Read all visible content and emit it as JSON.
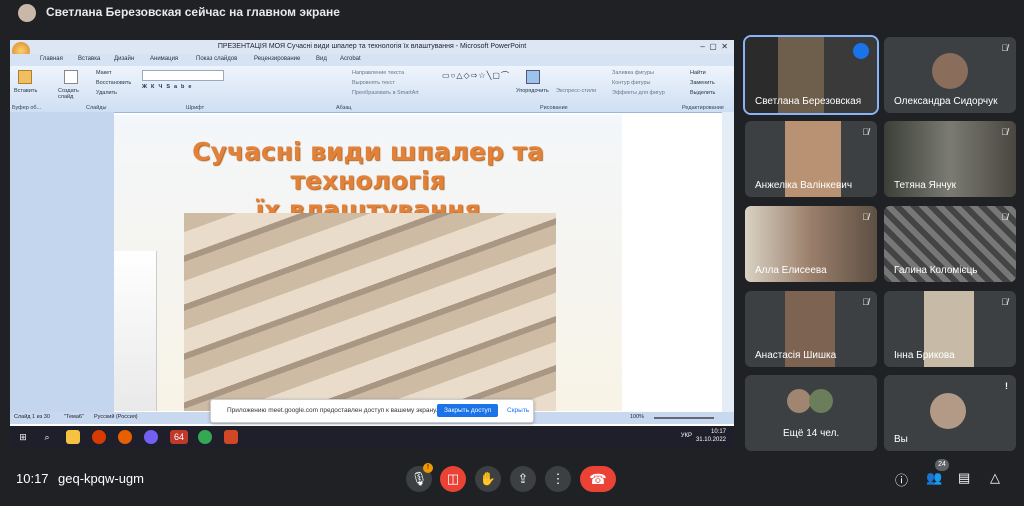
{
  "banner": {
    "text": "Светлана Березовская сейчас на главном экране"
  },
  "ppt": {
    "window_title": "ПРЕЗЕНТАЦІЯ МОЯ Сучасні види шпалер та технологія їх влаштування - Microsoft PowerPoint",
    "tabs": [
      "Главная",
      "Вставка",
      "Дизайн",
      "Анимация",
      "Показ слайдов",
      "Рецензирование",
      "Вид",
      "Acrobat"
    ],
    "groups": [
      "Буфер об...",
      "Слайды",
      "Шрифт",
      "Абзац",
      "Рисование",
      "Редактирование"
    ],
    "ribbon_items": {
      "paste": "Вставить",
      "create_slide": "Создать слайд",
      "layout": "Макет",
      "reset": "Восстановить",
      "delete": "Удалить",
      "text_direction": "Направление текста",
      "align_text": "Выровнять текст",
      "smartart": "Преобразовать в SmartArt",
      "arrange": "Упорядочить",
      "quick_styles": "Экспресс-стили",
      "shape_fill": "Заливка фигуры",
      "shape_outline": "Контур фигуры",
      "shape_effects": "Эффекты для фигур",
      "find": "Найти",
      "replace": "Заменить",
      "select": "Выделить"
    },
    "slide_title_line1": "Сучасні види шпалер та технологія",
    "slide_title_line2": "їх влаштування",
    "status_slide": "Слайд 1 из 30",
    "status_theme": "\"Тема6\"",
    "status_lang": "Русский (Россия)",
    "zoom": "100%",
    "notification": {
      "message": "Приложению meet.google.com предоставлен доступ к вашему экрану.",
      "close_access": "Закрыть доступ",
      "hide": "Скрыть"
    },
    "taskbar": {
      "badge": "64",
      "lang": "УКР",
      "time": "10:17",
      "date": "31.10.2022"
    }
  },
  "participants": [
    {
      "name": "Светлана Березовская",
      "active": true
    },
    {
      "name": "Олександра Сидорчук"
    },
    {
      "name": "Анжеліка Валінкевич"
    },
    {
      "name": "Тетяна Янчук"
    },
    {
      "name": "Алла Елисеева"
    },
    {
      "name": "Галина Коломієць"
    },
    {
      "name": "Анастасія Шишка"
    },
    {
      "name": "Інна Брикова"
    },
    {
      "name": "Ещё 14 чел."
    },
    {
      "name": "Вы"
    }
  ],
  "bottom": {
    "time": "10:17",
    "code": "geq-kpqw-ugm",
    "people_count": "24"
  },
  "icons": [
    "mic-icon",
    "camera-off-icon",
    "raise-hand-icon",
    "present-icon",
    "more-icon",
    "hangup-icon",
    "info-icon",
    "people-icon",
    "chat-icon",
    "activities-icon"
  ]
}
